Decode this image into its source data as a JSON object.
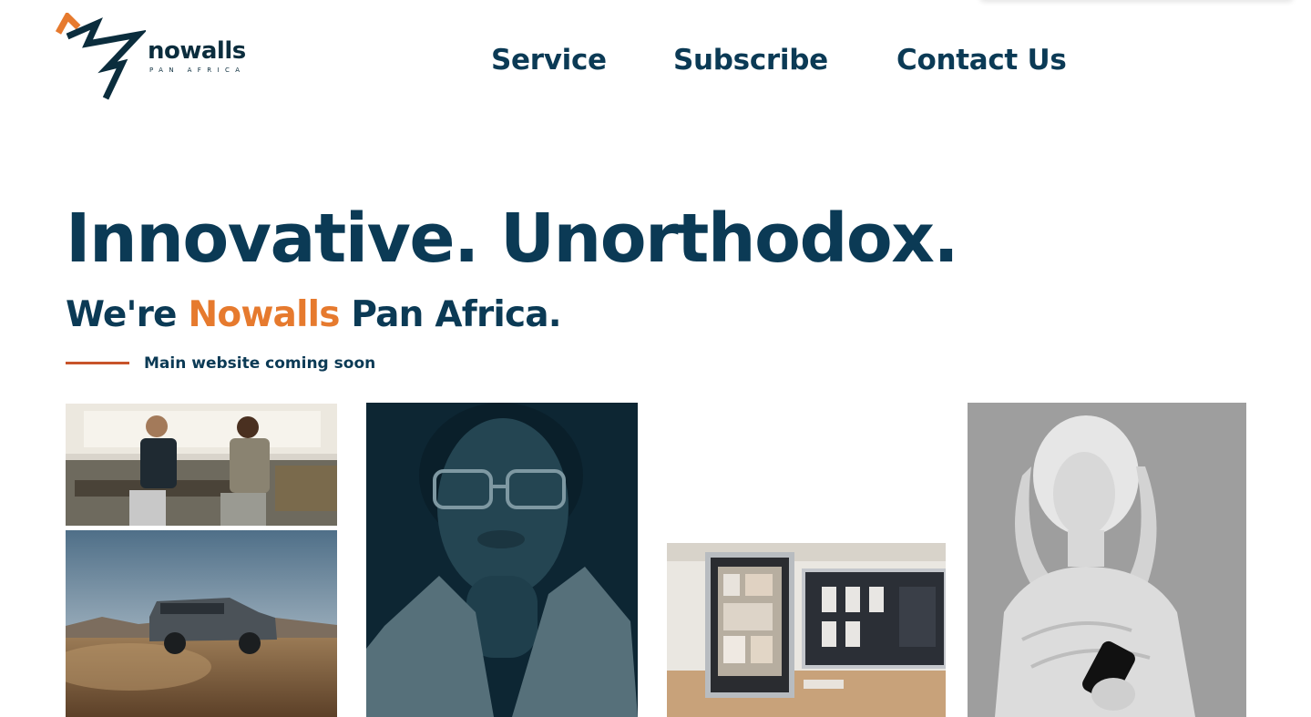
{
  "logo": {
    "wordmark": "nowalls",
    "subline": "PAN AFRICA",
    "colors": {
      "mark_dark": "#0b2d3d",
      "mark_accent": "#e67a2e"
    }
  },
  "nav": {
    "items": [
      {
        "label": "Service"
      },
      {
        "label": "Subscribe"
      },
      {
        "label": "Contact Us"
      }
    ]
  },
  "hero": {
    "title": "Innovative. Unorthodox.",
    "subtitle_prefix": "We're",
    "subtitle_brand": "Nowalls",
    "subtitle_suffix": "Pan Africa.",
    "tagline": "Main website coming soon"
  },
  "gallery": {
    "images": [
      {
        "name": "meeting-photo"
      },
      {
        "name": "suv-desert-photo"
      },
      {
        "name": "woman-glasses-portrait-photo"
      },
      {
        "name": "desk-monitors-photo"
      },
      {
        "name": "statue-with-phone-photo"
      }
    ]
  },
  "colors": {
    "primary": "#0b3a55",
    "accent": "#e67a2e",
    "rule": "#c8532a",
    "background": "#ffffff"
  }
}
